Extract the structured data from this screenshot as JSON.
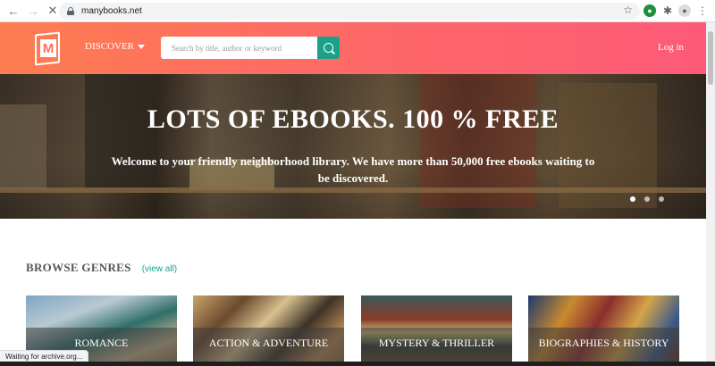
{
  "browser": {
    "url": "manybooks.net",
    "status_text": "Waiting for archive.org...",
    "icons": [
      "back-arrow-icon",
      "forward-arrow-icon",
      "stop-loading-icon",
      "lock-icon",
      "star-icon",
      "extension-icon",
      "puzzle-icon",
      "profile-icon",
      "menu-icon"
    ]
  },
  "header": {
    "logo_letter": "M",
    "discover_label": "DISCOVER",
    "search_placeholder": "Search by title, author or keyword",
    "login_label": "Log in",
    "accent_color": "#1aa189",
    "gradient_start": "#fd7d50",
    "gradient_end": "#fd5a78"
  },
  "hero": {
    "title": "LOTS OF EBOOKS. 100 % FREE",
    "subtitle": "Welcome to your friendly neighborhood library. We have more than 50,000 free ebooks waiting to be discovered.",
    "slides": 3,
    "active_slide": 1
  },
  "genres": {
    "title": "BROWSE GENRES",
    "view_all": "(view all)",
    "items": [
      {
        "label": "ROMANCE"
      },
      {
        "label": "ACTION & ADVENTURE"
      },
      {
        "label": "MYSTERY & THRILLER"
      },
      {
        "label": "BIOGRAPHIES & HISTORY"
      }
    ]
  }
}
